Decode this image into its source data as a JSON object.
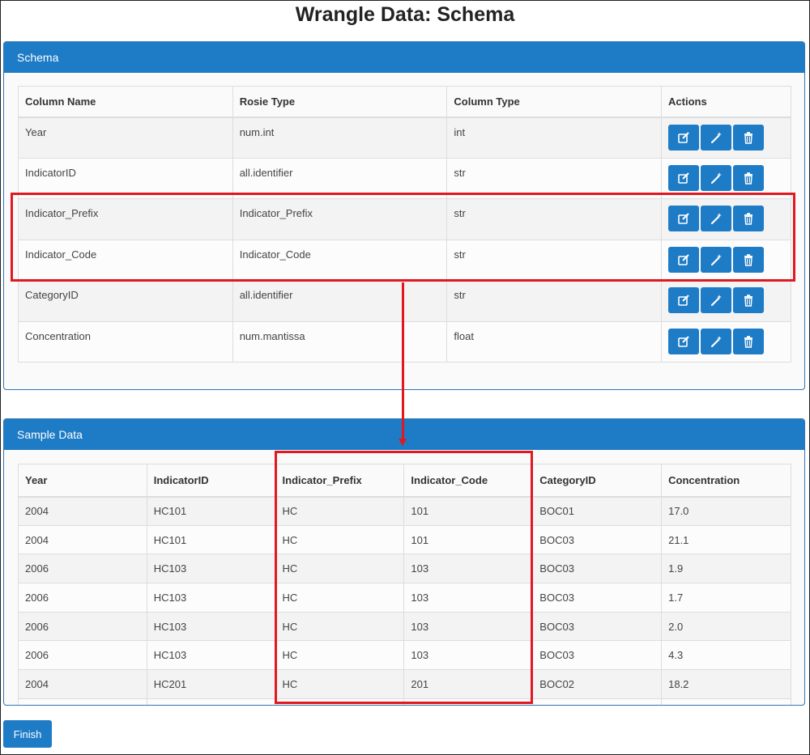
{
  "page": {
    "title": "Wrangle Data: Schema"
  },
  "schema_panel": {
    "heading": "Schema",
    "headers": {
      "column_name": "Column Name",
      "rosie_type": "Rosie Type",
      "column_type": "Column Type",
      "actions": "Actions"
    },
    "rows": [
      {
        "column_name": "Year",
        "rosie_type": "num.int",
        "column_type": "int"
      },
      {
        "column_name": "IndicatorID",
        "rosie_type": "all.identifier",
        "column_type": "str"
      },
      {
        "column_name": "Indicator_Prefix",
        "rosie_type": "Indicator_Prefix",
        "column_type": "str"
      },
      {
        "column_name": "Indicator_Code",
        "rosie_type": "Indicator_Code",
        "column_type": "str"
      },
      {
        "column_name": "CategoryID",
        "rosie_type": "all.identifier",
        "column_type": "str"
      },
      {
        "column_name": "Concentration",
        "rosie_type": "num.mantissa",
        "column_type": "float"
      }
    ],
    "row_actions": [
      "edit-icon",
      "magic-wand-icon",
      "trash-icon"
    ]
  },
  "sample_panel": {
    "heading": "Sample Data",
    "headers": [
      "Year",
      "IndicatorID",
      "Indicator_Prefix",
      "Indicator_Code",
      "CategoryID",
      "Concentration"
    ],
    "rows": [
      [
        "2004",
        "HC101",
        "HC",
        "101",
        "BOC01",
        "17.0"
      ],
      [
        "2004",
        "HC101",
        "HC",
        "101",
        "BOC03",
        "21.1"
      ],
      [
        "2006",
        "HC103",
        "HC",
        "103",
        "BOC03",
        "1.9"
      ],
      [
        "2006",
        "HC103",
        "HC",
        "103",
        "BOC03",
        "1.7"
      ],
      [
        "2006",
        "HC103",
        "HC",
        "103",
        "BOC03",
        "2.0"
      ],
      [
        "2006",
        "HC103",
        "HC",
        "103",
        "BOC03",
        "4.3"
      ],
      [
        "2004",
        "HC201",
        "HC",
        "201",
        "BOC02",
        "18.2"
      ]
    ]
  },
  "footer": {
    "finish_label": "Finish"
  },
  "colors": {
    "primary": "#1e7bc6",
    "highlight": "#e0181f"
  }
}
